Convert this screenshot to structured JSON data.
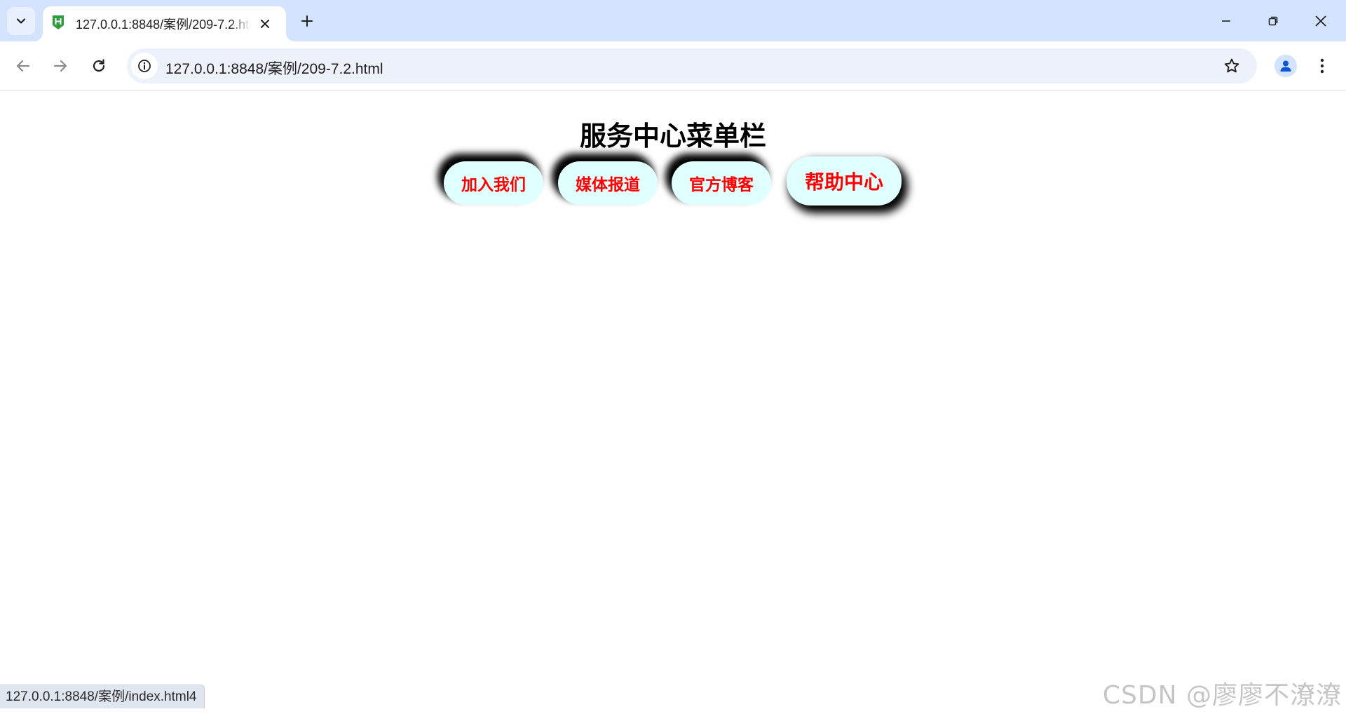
{
  "browser": {
    "tab_title": "127.0.0.1:8848/案例/209-7.2.html",
    "url": "127.0.0.1:8848/案例/209-7.2.html",
    "status_url": "127.0.0.1:8848/案例/index.html4"
  },
  "page": {
    "title": "服务中心菜单栏",
    "menu": [
      {
        "label": "加入我们"
      },
      {
        "label": "媒体报道"
      },
      {
        "label": "官方博客"
      },
      {
        "label": "帮助中心",
        "hovered": true
      }
    ]
  },
  "watermark": "CSDN @廖廖不潦潦",
  "colors": {
    "menu_bg": "#e0ffff",
    "menu_text": "#ff0000",
    "tab_strip": "#d3e3fd",
    "omnibox": "#edf2fa"
  }
}
